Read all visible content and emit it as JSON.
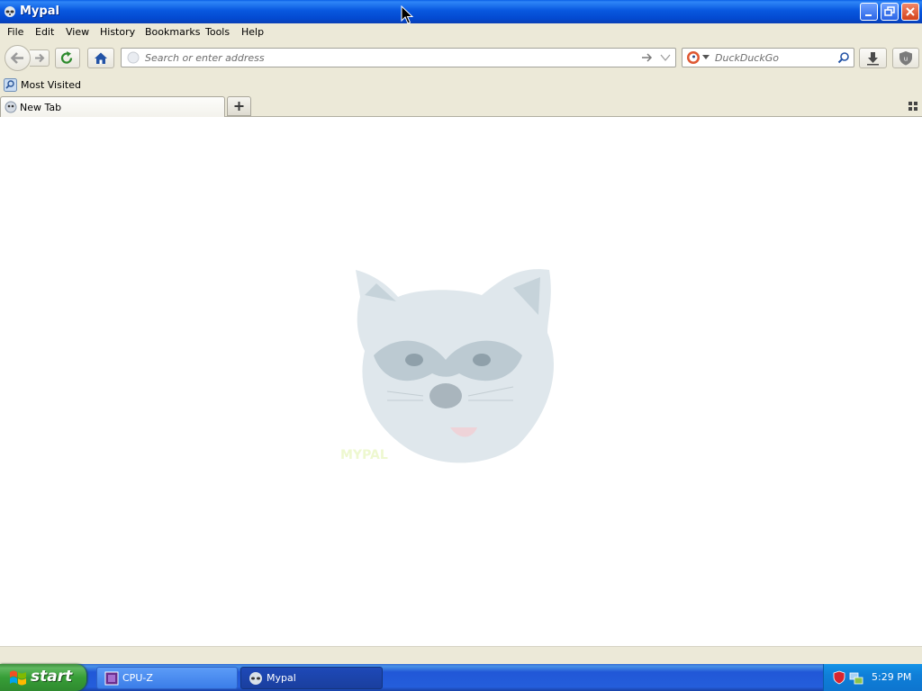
{
  "window": {
    "title": "Mypal"
  },
  "menu": [
    "File",
    "Edit",
    "View",
    "History",
    "Bookmarks",
    "Tools",
    "Help"
  ],
  "urlbar": {
    "placeholder": "Search or enter address"
  },
  "searchbar": {
    "engine": "DuckDuckGo"
  },
  "bookmarks": {
    "most_visited": "Most Visited"
  },
  "tabs": [
    {
      "label": "New Tab"
    }
  ],
  "taskbar": {
    "start": "start",
    "tasks": [
      {
        "label": "CPU-Z"
      },
      {
        "label": "Mypal"
      }
    ],
    "clock": "5:29 PM"
  },
  "content": {
    "logo_text": "MYPAL"
  },
  "colors": {
    "titlebar": "#0858df",
    "taskbar": "#245edb",
    "start": "#379e37",
    "content_bg": "#ffffff"
  }
}
